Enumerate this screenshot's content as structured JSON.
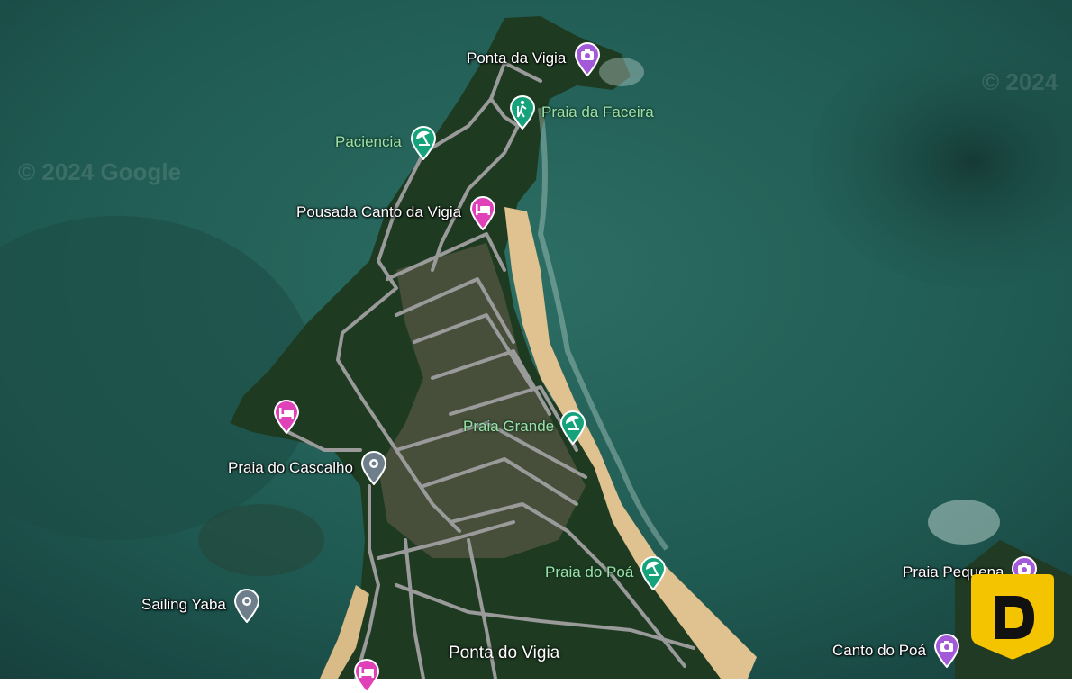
{
  "map": {
    "watermark": "© 2024 Google",
    "watermark2": "© 2024",
    "places": [
      {
        "label": "Ponta da Vigia",
        "kind": "attraction"
      },
      {
        "label": "Praia da Faceira",
        "kind": "hiking"
      },
      {
        "label": "Paciencia",
        "kind": "beach"
      },
      {
        "label": "Pousada Canto da Vigia",
        "kind": "hotel"
      },
      {
        "label": "Praia Grande",
        "kind": "beach"
      },
      {
        "label": "Praia do Cascalho",
        "kind": "place"
      },
      {
        "label": "Praia do Poá",
        "kind": "beach"
      },
      {
        "label": "Sailing Yaba",
        "kind": "place"
      },
      {
        "label": "Praia Pequena",
        "kind": "attraction"
      },
      {
        "label": "Canto do Poá",
        "kind": "attraction"
      },
      {
        "label": "Ponta do Vigia",
        "kind": "area"
      },
      {
        "label": "",
        "kind": "hotel"
      },
      {
        "label": "",
        "kind": "hotel"
      }
    ],
    "colors": {
      "ocean": "#1f5a52",
      "land": "#1e3b22",
      "sand": "#e0c190",
      "road": "#9a9a9a",
      "attraction": "#a35ad8",
      "beach": "#16a37b",
      "hotel": "#e040b8",
      "place": "#6e7f8b"
    }
  },
  "badge": {
    "letter": "D",
    "color": "#f5c400"
  }
}
